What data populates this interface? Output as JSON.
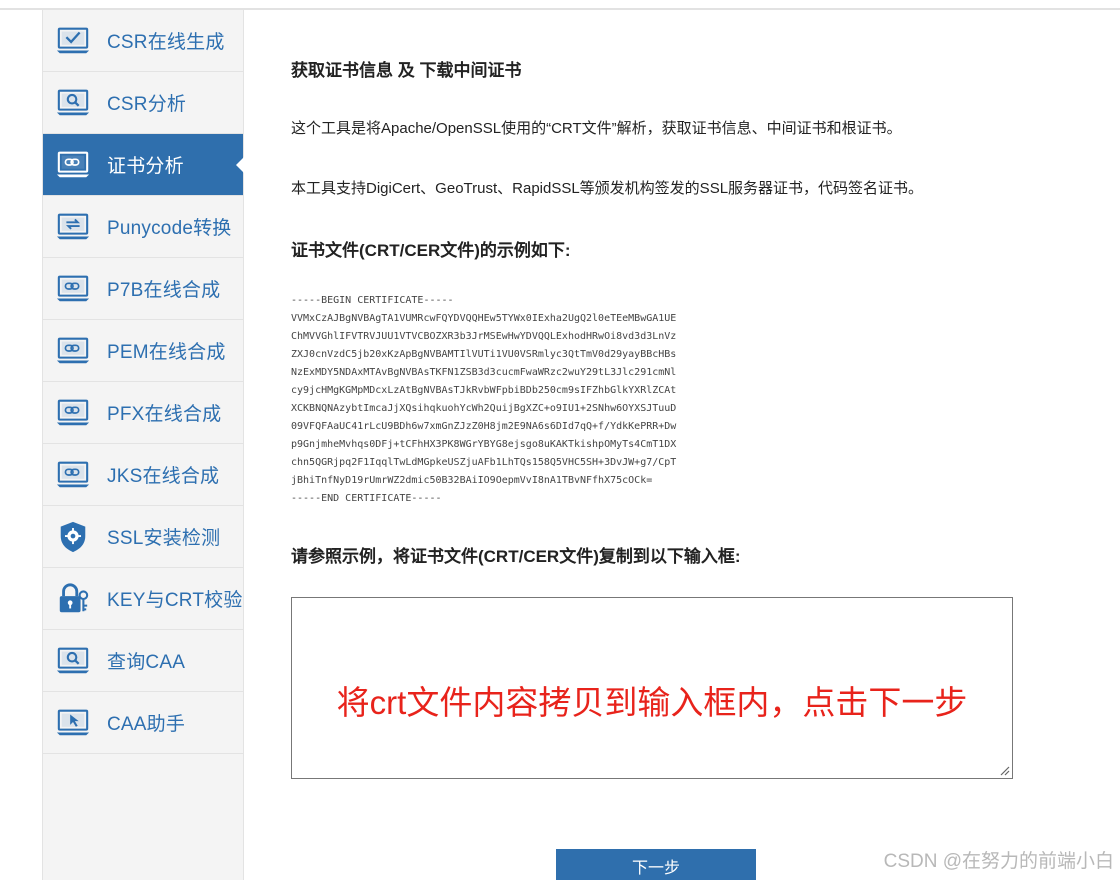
{
  "sidebar": {
    "items": [
      {
        "label": "CSR在线生成",
        "icon": "monitor-check-icon"
      },
      {
        "label": "CSR分析",
        "icon": "monitor-search-icon"
      },
      {
        "label": "证书分析",
        "icon": "monitor-link-icon",
        "active": true
      },
      {
        "label": "Punycode转换",
        "icon": "monitor-convert-icon"
      },
      {
        "label": "P7B在线合成",
        "icon": "monitor-link-icon"
      },
      {
        "label": "PEM在线合成",
        "icon": "monitor-link-icon"
      },
      {
        "label": "PFX在线合成",
        "icon": "monitor-link-icon"
      },
      {
        "label": "JKS在线合成",
        "icon": "monitor-link-icon"
      },
      {
        "label": "SSL安装检测",
        "icon": "shield-gear-icon"
      },
      {
        "label": "KEY与CRT校验",
        "icon": "lock-key-icon"
      },
      {
        "label": "查询CAA",
        "icon": "monitor-search-icon"
      },
      {
        "label": "CAA助手",
        "icon": "monitor-pointer-icon"
      }
    ]
  },
  "main": {
    "title": "获取证书信息 及 下载中间证书",
    "desc1": "这个工具是将Apache/OpenSSL使用的“CRT文件”解析，获取证书信息、中间证书和根证书。",
    "desc2": "本工具支持DigiCert、GeoTrust、RapidSSL等颁发机构签发的SSL服务器证书，代码签名证书。",
    "example_heading": "证书文件(CRT/CER文件)的示例如下:",
    "certificate_example": "-----BEGIN CERTIFICATE-----\nVVMxCzAJBgNVBAgTA1VUMRcwFQYDVQQHEw5TYWx0IExha2UgQ2l0eTEeMBwGA1UE\nChMVVGhlIFVTRVJUU1VTVCBOZXR3b3JrMSEwHwYDVQQLExhodHRwOi8vd3d3LnVz\nZXJ0cnVzdC5jb20xKzApBgNVBAMTIlVUTi1VU0VSRmlyc3QtTmV0d29yayBBcHBs\nNzExMDY5NDAxMTAvBgNVBAsTKFN1ZSB3d3cucmFwaWRzc2wuY29tL3Jlc291cmNl\ncy9jcHMgKGMpMDcxLzAtBgNVBAsTJkRvbWFpbiBDb250cm9sIFZhbGlkYXRlZCAt\nXCKBNQNAzybtImcaJjXQsihqkuohYcWh2QuijBgXZC+o9IU1+2SNhw6OYXSJTuuD\n09VFQFAaUC41rLcU9BDh6w7xmGnZJzZ0H8jm2E9NA6s6DId7qQ+f/YdkKePRR+Dw\np9GnjmheMvhqs0DFj+tCFhHX3PK8WGrYBYG8ejsgo8uKAKTkishpOMyTs4CmT1DX\nchn5QGRjpq2F1IqqlTwLdMGpkeUSZjuAFb1LhTQs158Q5VHC5SH+3DvJW+g7/CpT\njBhiTnfNyD19rUmrWZ2dmic50B32BAiIO9OepmVvI8nA1TBvNFfhX75cOCk=\n-----END CERTIFICATE-----",
    "instruction_heading": "请参照示例，将证书文件(CRT/CER文件)复制到以下输入框:",
    "input_overlay_text": "将crt文件内容拷贝到输入框内，点击下一步",
    "next_button": "下一步"
  },
  "watermark": "CSDN @在努力的前端小白",
  "colors": {
    "sidebar_accent": "#2f6fad",
    "link_blue": "#2d6fb0",
    "annotation_red": "#e8231b"
  }
}
